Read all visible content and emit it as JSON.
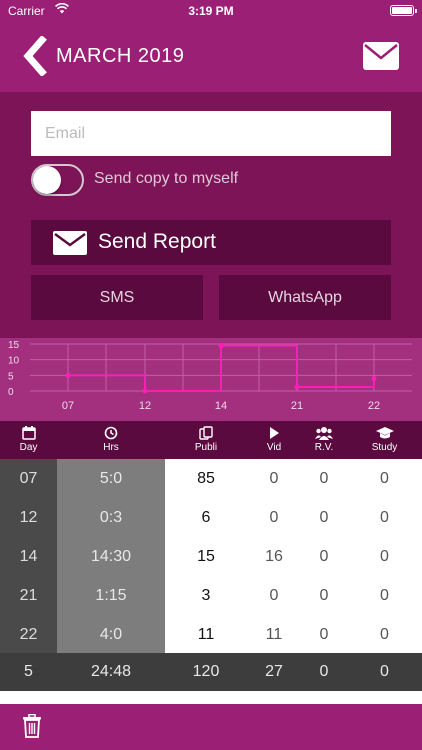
{
  "status_bar": {
    "carrier": "Carrier",
    "time": "3:19 PM"
  },
  "nav": {
    "title": "MARCH 2019",
    "back_icon": "chevron-left-icon",
    "mail_icon": "envelope-icon"
  },
  "report": {
    "email_placeholder": "Email",
    "email_value": "",
    "send_copy_label": "Send copy to myself",
    "send_copy_on": false,
    "send_button_label": "Send Report",
    "sms_label": "SMS",
    "whatsapp_label": "WhatsApp"
  },
  "chart_data": {
    "type": "line",
    "step": true,
    "x": [
      "07",
      "12",
      "14",
      "21",
      "22"
    ],
    "values": [
      5,
      0,
      14.5,
      1.25,
      4
    ],
    "y_ticks": [
      "15",
      "10",
      "5",
      "0"
    ],
    "ylim": [
      0,
      15
    ],
    "grid": true,
    "line_color": "#ff1fb8",
    "title": "",
    "xlabel": "",
    "ylabel": ""
  },
  "columns": [
    {
      "label": "Day",
      "icon": "calendar-icon"
    },
    {
      "label": "Hrs",
      "icon": "clock-icon"
    },
    {
      "label": "Publi",
      "icon": "copy-icon"
    },
    {
      "label": "Vid",
      "icon": "play-icon"
    },
    {
      "label": "R.V.",
      "icon": "group-icon"
    },
    {
      "label": "Study",
      "icon": "graduation-cap-icon"
    }
  ],
  "rows": [
    {
      "day": "07",
      "hrs": "5:0",
      "publi": "85",
      "vid": "0",
      "rv": "0",
      "study": "0"
    },
    {
      "day": "12",
      "hrs": "0:3",
      "publi": "6",
      "vid": "0",
      "rv": "0",
      "study": "0"
    },
    {
      "day": "14",
      "hrs": "14:30",
      "publi": "15",
      "vid": "16",
      "rv": "0",
      "study": "0"
    },
    {
      "day": "21",
      "hrs": "1:15",
      "publi": "3",
      "vid": "0",
      "rv": "0",
      "study": "0"
    },
    {
      "day": "22",
      "hrs": "4:0",
      "publi": "11",
      "vid": "11",
      "rv": "0",
      "study": "0"
    }
  ],
  "totals": {
    "day": "5",
    "hrs": "24:48",
    "publi": "120",
    "vid": "27",
    "rv": "0",
    "study": "0"
  },
  "bottom": {
    "trash_icon": "trash-icon"
  },
  "colors": {
    "primary": "#9b1f74",
    "panel": "#7e1458",
    "dark": "#5a0a3e",
    "chart_bg": "#a3307f"
  }
}
